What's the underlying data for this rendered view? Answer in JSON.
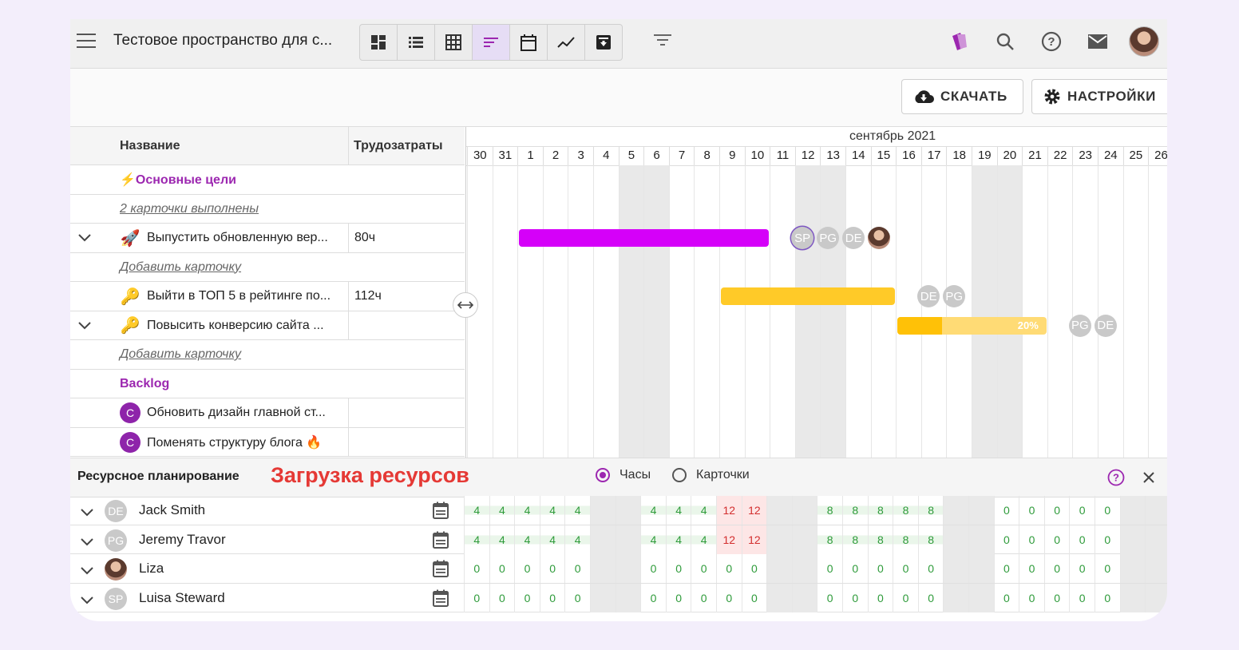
{
  "topbar": {
    "title": "Тестовое пространство для с...",
    "views": [
      "dashboard-icon",
      "list-icon",
      "table-icon",
      "gantt-icon",
      "calendar-icon",
      "chart-icon",
      "archive-icon"
    ],
    "active_view": "gantt-icon"
  },
  "toolbar": {
    "download_label": "СКАЧАТЬ",
    "settings_label": "НАСТРОЙКИ"
  },
  "gantt": {
    "headers": {
      "name": "Название",
      "effort": "Трудозатраты"
    },
    "rows": [
      {
        "kind": "group",
        "name": "⚡Основные цели"
      },
      {
        "kind": "link",
        "name": "2 карточки выполнены"
      },
      {
        "kind": "task",
        "expand": true,
        "emoji": "🚀",
        "name": "Выпустить обновленную вер...",
        "effort": "80ч"
      },
      {
        "kind": "link",
        "name": "Добавить карточку"
      },
      {
        "kind": "task",
        "expand": false,
        "emoji": "🔑",
        "name": "Выйти в ТОП 5 в рейтинге по...",
        "effort": "112ч"
      },
      {
        "kind": "task",
        "expand": true,
        "emoji": "🔑",
        "name": "Повысить конверсию сайта ...",
        "effort": ""
      },
      {
        "kind": "link",
        "name": "Добавить карточку"
      },
      {
        "kind": "group",
        "name": "Backlog"
      },
      {
        "kind": "card",
        "badge": "C",
        "name": "Обновить дизайн главной ст...",
        "effort": ""
      },
      {
        "kind": "card",
        "badge": "C",
        "name": "Поменять структуру блога 🔥",
        "effort": ""
      }
    ],
    "month": "сентябрь 2021",
    "days": [
      "30",
      "31",
      "1",
      "2",
      "3",
      "4",
      "5",
      "6",
      "7",
      "8",
      "9",
      "10",
      "11",
      "12",
      "13",
      "14",
      "15",
      "16",
      "17",
      "18",
      "19",
      "20",
      "21",
      "22",
      "23",
      "24",
      "25",
      "26"
    ],
    "weekend_days": [
      "5",
      "6",
      "12",
      "13",
      "19",
      "20"
    ],
    "bars": [
      {
        "row": 2,
        "start": "1",
        "end": "11",
        "color": "#d500f9",
        "progress_label": "",
        "assignees": [
          "SP",
          "PG",
          "DE",
          "photo"
        ]
      },
      {
        "row": 4,
        "start": "9",
        "end": "16",
        "color": "#ffca28",
        "progress_label": "",
        "assignees": [
          "DE",
          "PG"
        ]
      },
      {
        "row": 5,
        "start": "16",
        "end": "22",
        "color": "#ffdb75",
        "progress_color": "#ffc107",
        "progress": 0.3,
        "progress_label": "20%",
        "assignees": [
          "PG",
          "DE"
        ]
      }
    ]
  },
  "resources": {
    "title": "Ресурсное планирование",
    "annotation": "Загрузка ресурсов",
    "mode_hours": "Часы",
    "mode_cards": "Карточки",
    "selected_mode": "Часы",
    "people": [
      {
        "initials": "DE",
        "name": "Jack Smith",
        "values": [
          "4",
          "4",
          "4",
          "4",
          "4",
          "",
          "",
          "4",
          "4",
          "4",
          "12",
          "12",
          "",
          "",
          "8",
          "8",
          "8",
          "8",
          "8",
          "",
          "",
          "0",
          "0",
          "0",
          "0",
          "0",
          "",
          ""
        ]
      },
      {
        "initials": "PG",
        "name": "Jeremy Travor",
        "values": [
          "4",
          "4",
          "4",
          "4",
          "4",
          "",
          "",
          "4",
          "4",
          "4",
          "12",
          "12",
          "",
          "",
          "8",
          "8",
          "8",
          "8",
          "8",
          "",
          "",
          "0",
          "0",
          "0",
          "0",
          "0",
          "",
          ""
        ]
      },
      {
        "initials": "",
        "photo": true,
        "name": "Liza",
        "values": [
          "0",
          "0",
          "0",
          "0",
          "0",
          "",
          "",
          "0",
          "0",
          "0",
          "0",
          "0",
          "",
          "",
          "0",
          "0",
          "0",
          "0",
          "0",
          "",
          "",
          "0",
          "0",
          "0",
          "0",
          "0",
          "",
          ""
        ]
      },
      {
        "initials": "SP",
        "name": "Luisa Steward",
        "values": [
          "0",
          "0",
          "0",
          "0",
          "0",
          "",
          "",
          "0",
          "0",
          "0",
          "0",
          "0",
          "",
          "",
          "0",
          "0",
          "0",
          "0",
          "0",
          "",
          "",
          "0",
          "0",
          "0",
          "0",
          "0",
          "",
          ""
        ]
      }
    ]
  }
}
